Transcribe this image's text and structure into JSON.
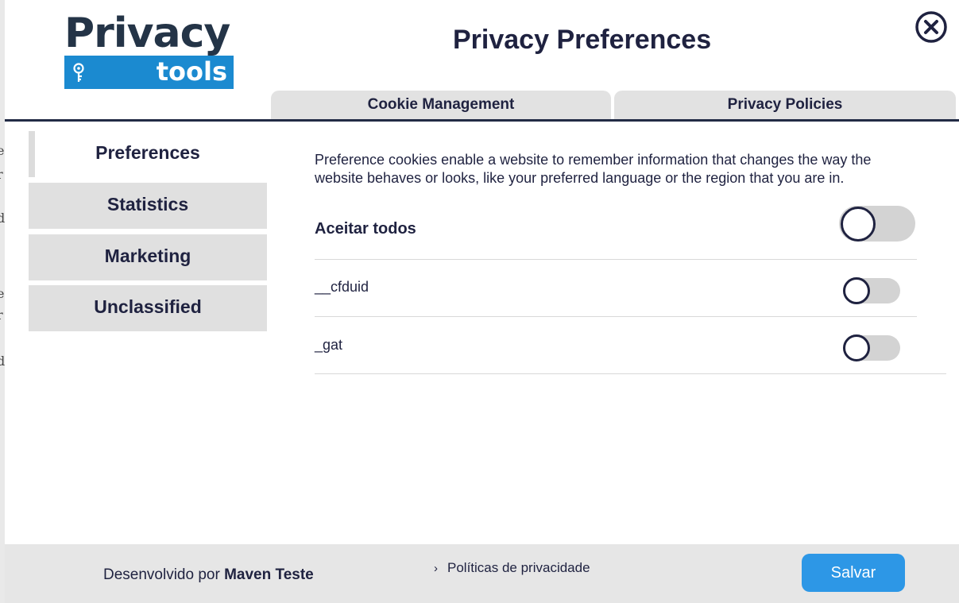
{
  "header": {
    "logo_primary": "Privacy",
    "logo_secondary": "tools",
    "title": "Privacy Preferences"
  },
  "tabs": [
    {
      "label": "Cookie Management"
    },
    {
      "label": "Privacy Policies"
    }
  ],
  "sidebar": {
    "items": [
      {
        "label": "Preferences",
        "active": true
      },
      {
        "label": "Statistics",
        "active": false
      },
      {
        "label": "Marketing",
        "active": false
      },
      {
        "label": "Unclassified",
        "active": false
      }
    ]
  },
  "content": {
    "description": "Preference cookies enable a website to remember information that changes the way the website behaves or looks, like your preferred language or the region that you are in.",
    "accept_all": {
      "label": "Aceitar todos",
      "enabled": false
    },
    "cookies": [
      {
        "name": "__cfduid",
        "enabled": false
      },
      {
        "name": "_gat",
        "enabled": false
      }
    ]
  },
  "footer": {
    "developed_by_prefix": "Desenvolvido por",
    "developer_name": "Maven Teste",
    "policies_link": "Políticas de privacidade",
    "save_label": "Salvar"
  },
  "colors": {
    "primary_text": "#1f2240",
    "accent_blue": "#2d97e6",
    "logo_blue": "#1b8ad0",
    "tab_bg": "#e2e2e2",
    "toggle_off": "#d3d3d3"
  },
  "icons": {
    "close": "close-circle-icon",
    "logo_key": "key-icon",
    "link": "chevron-right-icon"
  }
}
